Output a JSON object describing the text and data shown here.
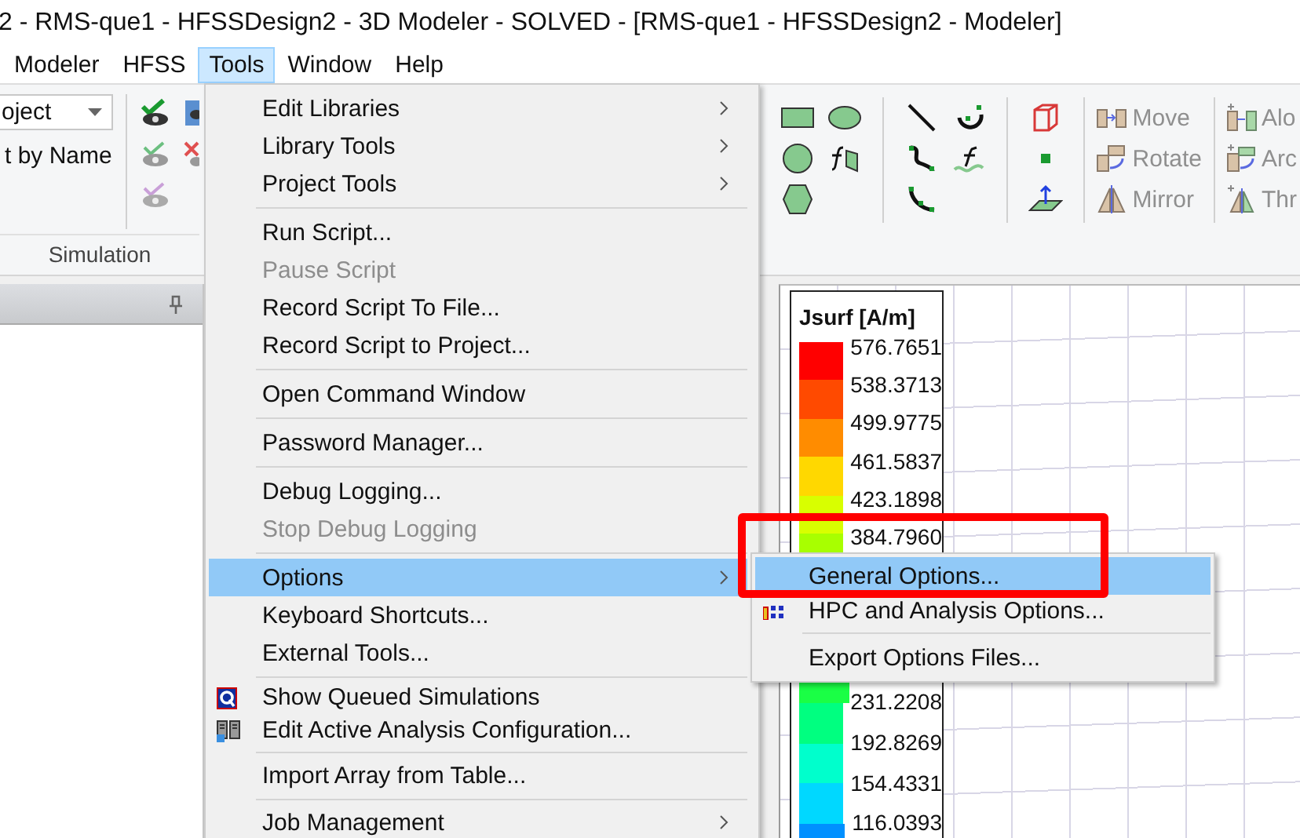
{
  "window": {
    "title": "2 - RMS-que1 - HFSSDesign2 - 3D Modeler - SOLVED - [RMS-que1 - HFSSDesign2 - Modeler]"
  },
  "menu_bar": [
    {
      "label": "Modeler",
      "selected": false
    },
    {
      "label": "HFSS",
      "selected": false
    },
    {
      "label": "Tools",
      "selected": true
    },
    {
      "label": "Window",
      "selected": false
    },
    {
      "label": "Help",
      "selected": false
    }
  ],
  "ribbon": {
    "project_field": {
      "value": "oject"
    },
    "sort_label": "t by Name",
    "group_label": "Simulation",
    "transform_buttons": [
      {
        "label": "Move",
        "disabled": true,
        "kind": "move"
      },
      {
        "label": "Rotate",
        "disabled": true,
        "kind": "rotate"
      },
      {
        "label": "Mirror",
        "disabled": true,
        "kind": "mirror"
      }
    ],
    "align_buttons": [
      {
        "label": "Alo",
        "disabled": true,
        "kind": "move"
      },
      {
        "label": "Arc",
        "disabled": true,
        "kind": "rotate"
      },
      {
        "label": "Thr",
        "disabled": true,
        "kind": "mirror"
      }
    ]
  },
  "tools_menu": {
    "items": [
      {
        "kind": "item",
        "label": "Edit Libraries",
        "disabled": false,
        "selected": false,
        "submenu": true
      },
      {
        "kind": "item",
        "label": "Library Tools",
        "disabled": false,
        "selected": false,
        "submenu": true
      },
      {
        "kind": "item",
        "label": "Project Tools",
        "disabled": false,
        "selected": false,
        "submenu": true
      },
      {
        "kind": "separator"
      },
      {
        "kind": "item",
        "label": "Run Script...",
        "disabled": false,
        "selected": false,
        "submenu": false
      },
      {
        "kind": "item",
        "label": "Pause Script",
        "disabled": true,
        "selected": false,
        "submenu": false
      },
      {
        "kind": "item",
        "label": "Record Script To File...",
        "disabled": false,
        "selected": false,
        "submenu": false
      },
      {
        "kind": "item",
        "label": "Record Script to Project...",
        "disabled": false,
        "selected": false,
        "submenu": false
      },
      {
        "kind": "separator"
      },
      {
        "kind": "item",
        "label": "Open Command Window",
        "disabled": false,
        "selected": false,
        "submenu": false
      },
      {
        "kind": "separator"
      },
      {
        "kind": "item",
        "label": "Password Manager...",
        "disabled": false,
        "selected": false,
        "submenu": false
      },
      {
        "kind": "separator"
      },
      {
        "kind": "item",
        "label": "Debug Logging...",
        "disabled": false,
        "selected": false,
        "submenu": false
      },
      {
        "kind": "item",
        "label": "Stop Debug Logging",
        "disabled": true,
        "selected": false,
        "submenu": false
      },
      {
        "kind": "separator"
      },
      {
        "kind": "item",
        "label": "Options",
        "disabled": false,
        "selected": true,
        "submenu": true
      },
      {
        "kind": "item",
        "label": "Keyboard Shortcuts...",
        "disabled": false,
        "selected": false,
        "submenu": false
      },
      {
        "kind": "item",
        "label": "External Tools...",
        "disabled": false,
        "selected": false,
        "submenu": false
      },
      {
        "kind": "separator"
      },
      {
        "kind": "item",
        "label": "Show Queued Simulations",
        "disabled": false,
        "selected": false,
        "submenu": false
      },
      {
        "kind": "item",
        "label": "Edit Active Analysis Configuration...",
        "disabled": false,
        "selected": false,
        "submenu": false
      },
      {
        "kind": "separator"
      },
      {
        "kind": "item",
        "label": "Import Array from Table...",
        "disabled": false,
        "selected": false,
        "submenu": false
      },
      {
        "kind": "separator"
      },
      {
        "kind": "item",
        "label": "Job Management",
        "disabled": false,
        "selected": false,
        "submenu": true
      }
    ]
  },
  "options_submenu": {
    "items": [
      {
        "kind": "item",
        "label": "General Options...",
        "disabled": false,
        "selected": true
      },
      {
        "kind": "item",
        "label": "HPC and Analysis Options...",
        "disabled": false,
        "selected": false
      },
      {
        "kind": "separator"
      },
      {
        "kind": "item",
        "label": "Export Options Files...",
        "disabled": false,
        "selected": false
      }
    ]
  },
  "legend": {
    "title": "Jsurf [A/m]",
    "upper": [
      {
        "value": "576.7651",
        "color": "#ff0000"
      },
      {
        "value": "538.3713",
        "color": "#ff4a00"
      },
      {
        "value": "499.9775",
        "color": "#ff8c00"
      },
      {
        "value": "461.5837",
        "color": "#ffd800"
      },
      {
        "value": "423.1898",
        "color": "#d8ff00"
      },
      {
        "value": "384.7960",
        "color": "#a8ff00"
      }
    ],
    "lower": [
      {
        "value": "231.2208",
        "color": "#00ff80"
      },
      {
        "value": "192.8269",
        "color": "#00ffcc"
      },
      {
        "value": "154.4331",
        "color": "#00d8ff"
      },
      {
        "value": "116.0393",
        "color": "#0090ff"
      }
    ]
  }
}
